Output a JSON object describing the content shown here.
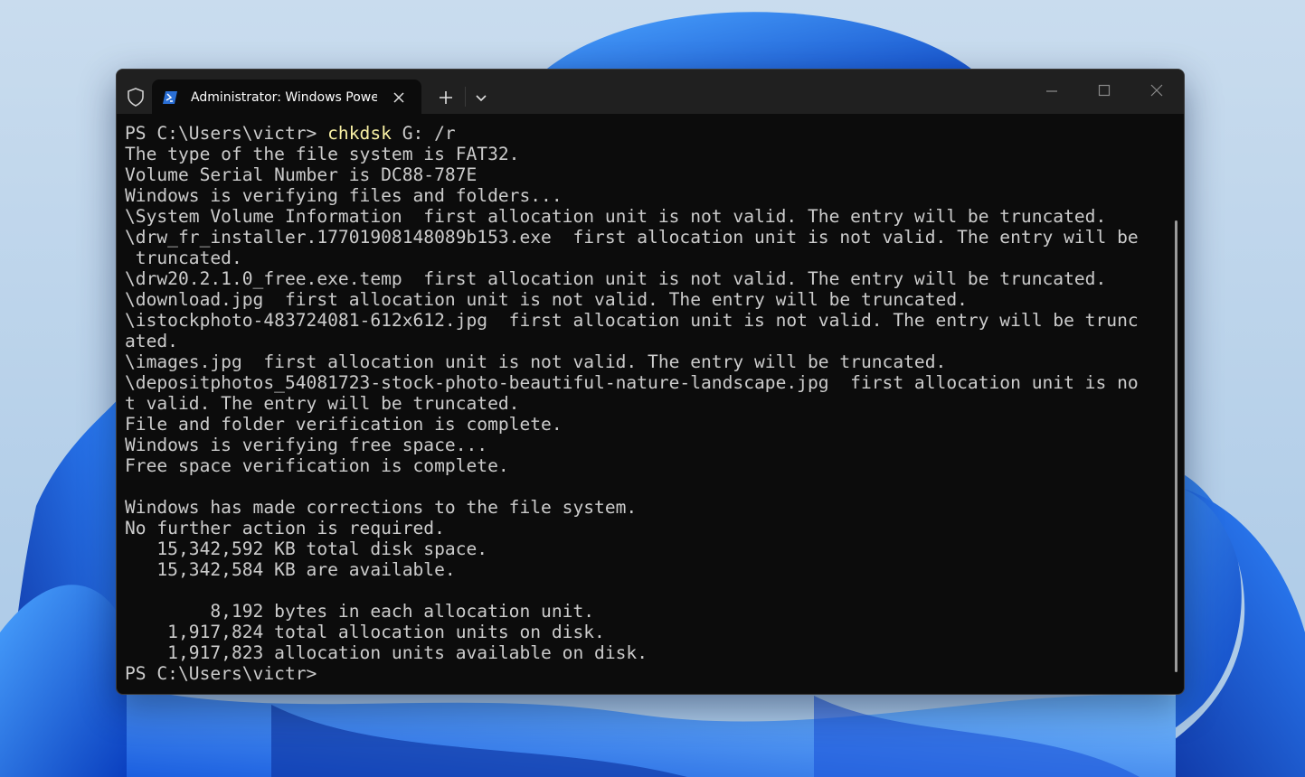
{
  "window": {
    "tab_title": "Administrator: Windows PowerShell"
  },
  "icons": {
    "shield": "shield-icon",
    "powershell": "powershell-icon",
    "tab_close": "close-icon",
    "new_tab": "plus-icon",
    "dropdown": "chevron-down-icon",
    "minimize": "minimize-icon",
    "maximize": "maximize-icon",
    "close": "close-icon"
  },
  "terminal": {
    "prompt_1": "PS C:\\Users\\victr> ",
    "command": "chkdsk",
    "command_args": " G: /r",
    "lines": [
      "The type of the file system is FAT32.",
      "Volume Serial Number is DC88-787E",
      "Windows is verifying files and folders...",
      "\\System Volume Information  first allocation unit is not valid. The entry will be truncated.",
      "\\drw_fr_installer.17701908148089b153.exe  first allocation unit is not valid. The entry will be",
      " truncated.",
      "\\drw20.2.1.0_free.exe.temp  first allocation unit is not valid. The entry will be truncated.",
      "\\download.jpg  first allocation unit is not valid. The entry will be truncated.",
      "\\istockphoto-483724081-612x612.jpg  first allocation unit is not valid. The entry will be trunc",
      "ated.",
      "\\images.jpg  first allocation unit is not valid. The entry will be truncated.",
      "\\depositphotos_54081723-stock-photo-beautiful-nature-landscape.jpg  first allocation unit is no",
      "t valid. The entry will be truncated.",
      "File and folder verification is complete.",
      "Windows is verifying free space...",
      "Free space verification is complete.",
      "",
      "Windows has made corrections to the file system.",
      "No further action is required.",
      "   15,342,592 KB total disk space.",
      "   15,342,584 KB are available.",
      "",
      "        8,192 bytes in each allocation unit.",
      "    1,917,824 total allocation units on disk.",
      "    1,917,823 allocation units available on disk."
    ],
    "prompt_2": "PS C:\\Users\\victr>"
  },
  "colors": {
    "terminal_bg": "#0c0c0c",
    "terminal_text": "#cccccc",
    "command_highlight": "#f9f1a5",
    "titlebar_bg": "#202020"
  }
}
